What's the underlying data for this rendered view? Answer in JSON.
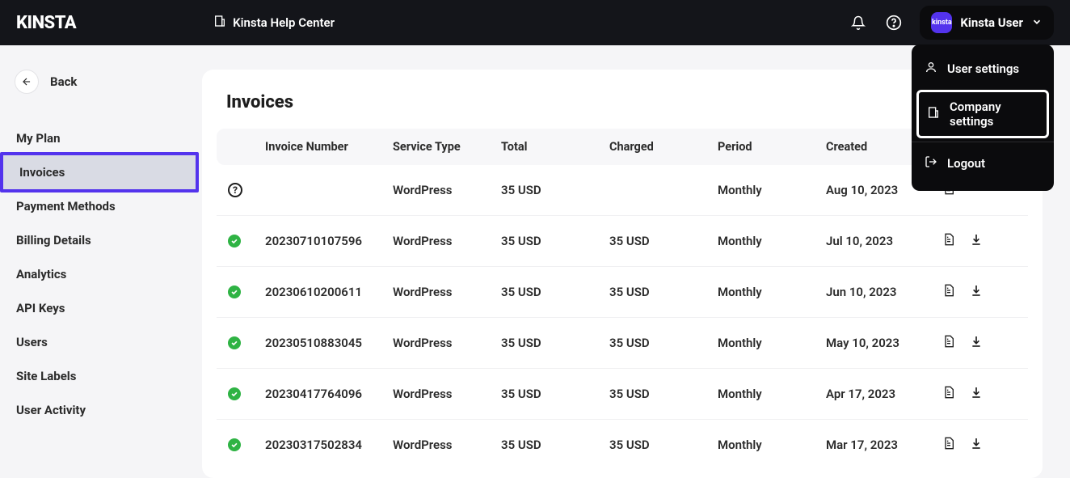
{
  "topbar": {
    "logo": "KINSTA",
    "help_center": "Kinsta Help Center",
    "user_name": "Kinsta User",
    "avatar_text": "kinsta"
  },
  "dropdown": {
    "user_settings": "User settings",
    "company_settings": "Company settings",
    "logout": "Logout"
  },
  "sidebar": {
    "back": "Back",
    "items": [
      "My Plan",
      "Invoices",
      "Payment Methods",
      "Billing Details",
      "Analytics",
      "API Keys",
      "Users",
      "Site Labels",
      "User Activity"
    ]
  },
  "page": {
    "title": "Invoices"
  },
  "table": {
    "headers": {
      "invoice": "Invoice Number",
      "service": "Service Type",
      "total": "Total",
      "charged": "Charged",
      "period": "Period",
      "created": "Created"
    },
    "rows": [
      {
        "status": "pending",
        "invoice": "",
        "service": "WordPress",
        "total": "35 USD",
        "charged": "",
        "period": "Monthly",
        "created": "Aug 10, 2023",
        "has_download": false
      },
      {
        "status": "ok",
        "invoice": "20230710107596",
        "service": "WordPress",
        "total": "35 USD",
        "charged": "35 USD",
        "period": "Monthly",
        "created": "Jul 10, 2023",
        "has_download": true
      },
      {
        "status": "ok",
        "invoice": "20230610200611",
        "service": "WordPress",
        "total": "35 USD",
        "charged": "35 USD",
        "period": "Monthly",
        "created": "Jun 10, 2023",
        "has_download": true
      },
      {
        "status": "ok",
        "invoice": "20230510883045",
        "service": "WordPress",
        "total": "35 USD",
        "charged": "35 USD",
        "period": "Monthly",
        "created": "May 10, 2023",
        "has_download": true
      },
      {
        "status": "ok",
        "invoice": "20230417764096",
        "service": "WordPress",
        "total": "35 USD",
        "charged": "35 USD",
        "period": "Monthly",
        "created": "Apr 17, 2023",
        "has_download": true
      },
      {
        "status": "ok",
        "invoice": "20230317502834",
        "service": "WordPress",
        "total": "35 USD",
        "charged": "35 USD",
        "period": "Monthly",
        "created": "Mar 17, 2023",
        "has_download": true
      }
    ]
  }
}
